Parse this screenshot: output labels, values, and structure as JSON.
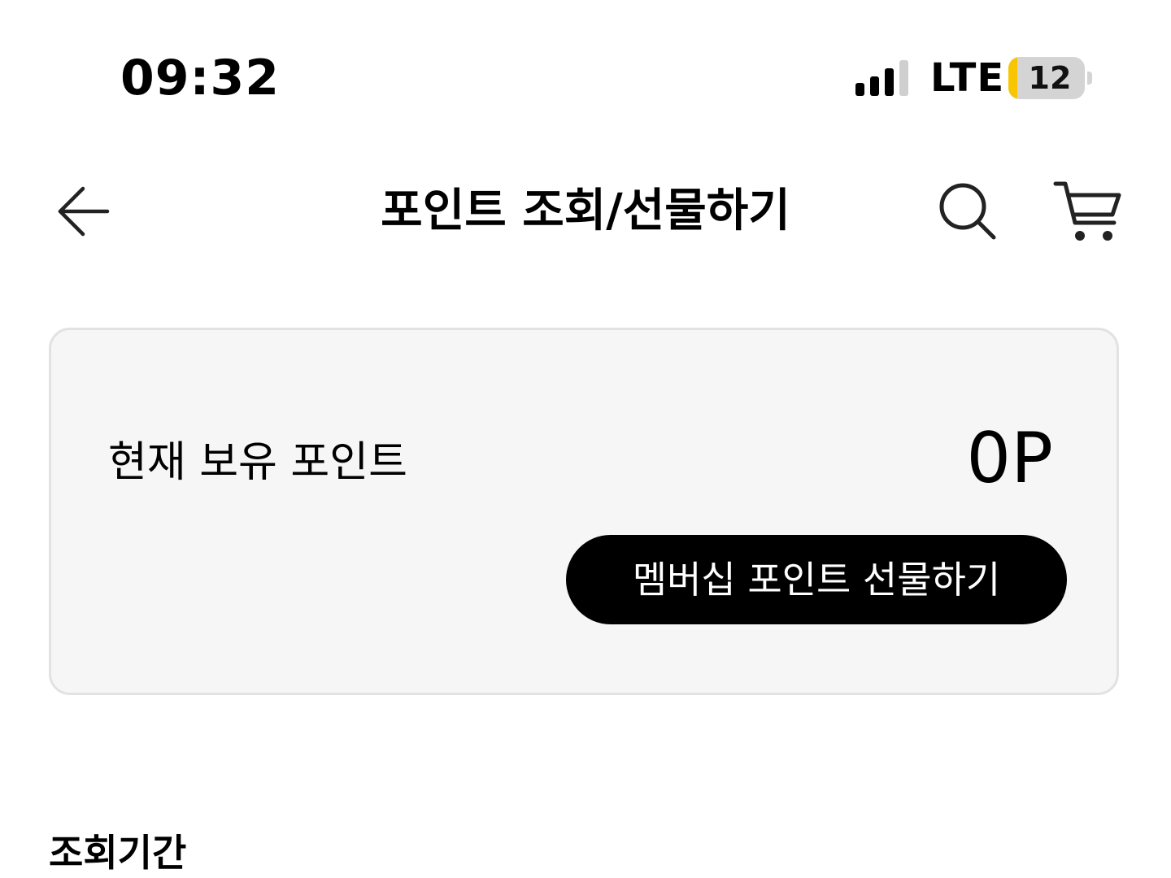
{
  "status_bar": {
    "time": "09:32",
    "network": "LTE",
    "battery_level": "12",
    "battery_fraction": 0.12,
    "signal_icon": "cellular-signal-icon"
  },
  "header": {
    "title": "포인트 조회/선물하기",
    "back_icon": "back-arrow-icon",
    "search_icon": "search-icon",
    "cart_icon": "cart-icon"
  },
  "points_card": {
    "label": "현재 보유 포인트",
    "value": "0P",
    "gift_button_label": "멤버십 포인트 선물하기"
  },
  "period_section": {
    "title": "조회기간"
  },
  "colors": {
    "card_background": "#f6f6f6",
    "card_border": "#e2e2e2",
    "button_background": "#000000",
    "button_text": "#ffffff",
    "battery_accent": "#f7c600"
  }
}
